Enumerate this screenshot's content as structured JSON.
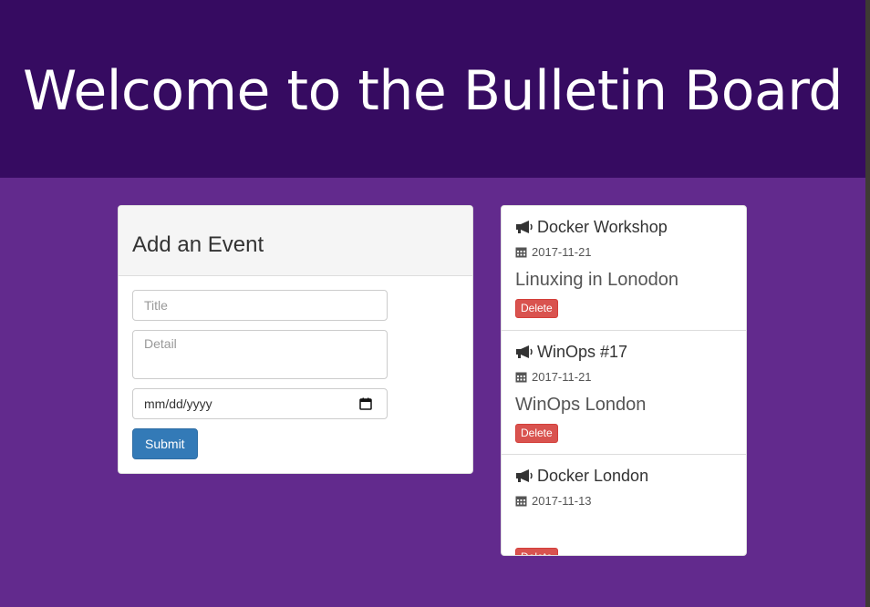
{
  "header": {
    "title": "Welcome to the Bulletin Board"
  },
  "form": {
    "heading": "Add an Event",
    "title_placeholder": "Title",
    "detail_placeholder": "Detail",
    "date_placeholder": "mm/dd/yyyy",
    "submit_label": "Submit"
  },
  "events": [
    {
      "title": "Docker Workshop",
      "date": "2017-11-21",
      "detail": "Linuxing in Lonodon",
      "delete_label": "Delete"
    },
    {
      "title": "WinOps #17",
      "date": "2017-11-21",
      "detail": "WinOps London",
      "delete_label": "Delete"
    },
    {
      "title": "Docker London",
      "date": "2017-11-13",
      "detail": "",
      "delete_label": "Delete"
    }
  ],
  "colors": {
    "header_bg": "#360b61",
    "page_bg": "#622a8d",
    "primary": "#337ab7",
    "danger": "#d9534f"
  },
  "icons": {
    "event": "bullhorn-icon",
    "date": "calendar-icon"
  }
}
